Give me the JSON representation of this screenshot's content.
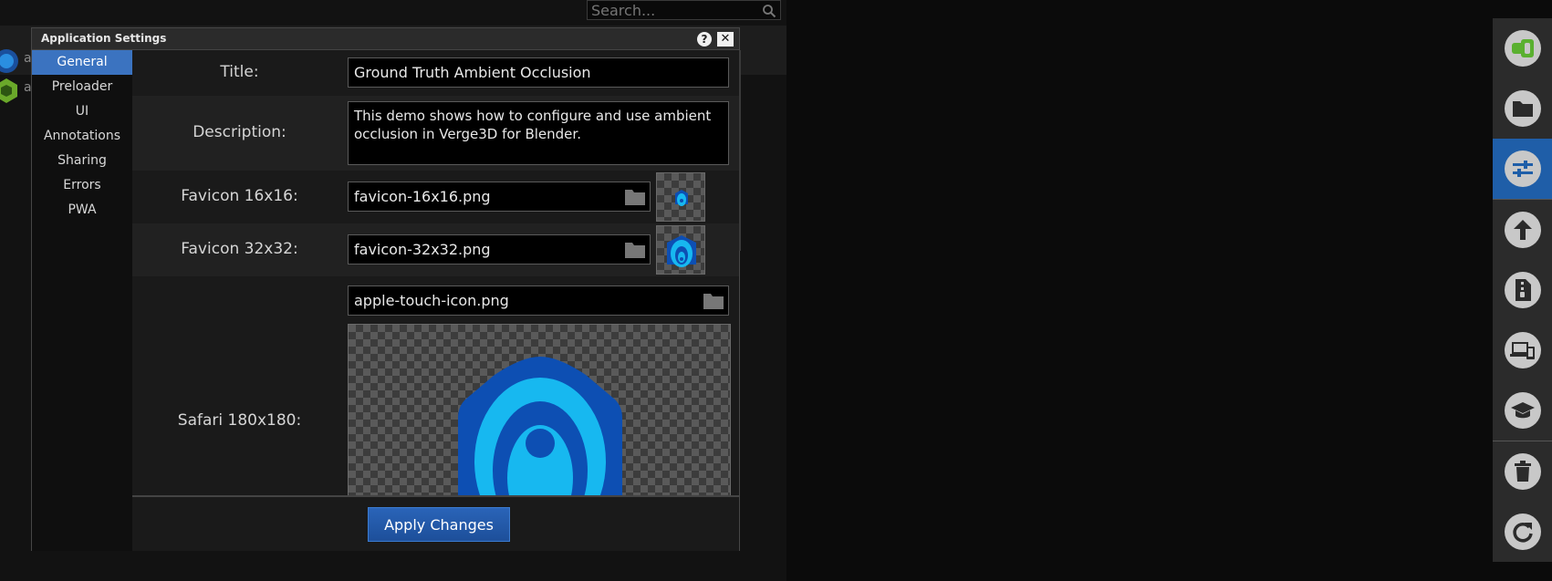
{
  "search": {
    "placeholder": "Search..."
  },
  "background": {
    "items": [
      "a",
      "a"
    ]
  },
  "modal": {
    "title": "Application Settings",
    "help_label": "?",
    "close_label": "✕"
  },
  "sidebar": {
    "items": [
      "General",
      "Preloader",
      "UI",
      "Annotations",
      "Sharing",
      "Errors",
      "PWA"
    ],
    "active": "General"
  },
  "fields": {
    "title": {
      "label": "Title:",
      "value": "Ground Truth Ambient Occlusion"
    },
    "description": {
      "label": "Description:",
      "value": "This demo shows how to configure and use ambient occlusion in Verge3D for Blender."
    },
    "favicon16": {
      "label": "Favicon 16x16:",
      "value": "favicon-16x16.png"
    },
    "favicon32": {
      "label": "Favicon 32x32:",
      "value": "favicon-32x32.png"
    },
    "safari": {
      "label": "Safari 180x180:",
      "value": "apple-touch-icon.png"
    }
  },
  "footer": {
    "apply_label": "Apply Changes"
  },
  "toolbar": {
    "icons": [
      "new-project-icon",
      "folder-icon",
      "settings-sliders-icon",
      "upload-icon",
      "zip-file-icon",
      "devices-icon",
      "graduation-cap-icon",
      "trash-icon",
      "refresh-icon"
    ],
    "active": "settings-sliders-icon"
  },
  "colors": {
    "accent_blue": "#3b73c0",
    "logo_light_blue": "#17b8f0",
    "logo_dark_blue": "#0d4fb3",
    "toolbar_green": "#5ab030"
  }
}
